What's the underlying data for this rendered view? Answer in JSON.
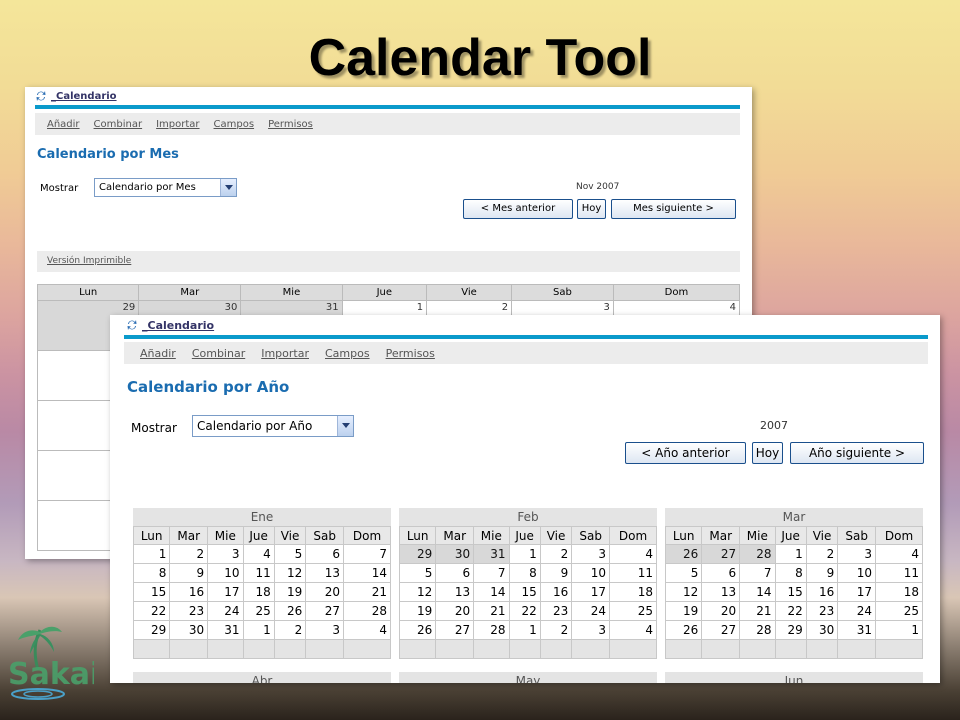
{
  "slide": {
    "title": "Calendar Tool",
    "logo_text": "Sakai"
  },
  "month_view": {
    "tool_name": "_Calendario",
    "menu": [
      "Añadir",
      "Combinar",
      "Importar",
      "Campos",
      "Permisos"
    ],
    "title": "Calendario por Mes",
    "show_label": "Mostrar",
    "view_select": "Calendario por Mes",
    "period": "Nov 2007",
    "btn_prev": "< Mes anterior",
    "btn_today": "Hoy",
    "btn_next": "Mes siguiente >",
    "printable": "Versión Imprimible",
    "weekdays": [
      "Lun",
      "Mar",
      "Mie",
      "Jue",
      "Vie",
      "Sab",
      "Dom"
    ],
    "first_week": [
      "29",
      "30",
      "31",
      "1",
      "2",
      "3",
      "4"
    ]
  },
  "year_view": {
    "tool_name": "_Calendario",
    "menu": [
      "Añadir",
      "Combinar",
      "Importar",
      "Campos",
      "Permisos"
    ],
    "title": "Calendario por Año",
    "show_label": "Mostrar",
    "view_select": "Calendario por Año",
    "period": "2007",
    "btn_prev": "< Año anterior",
    "btn_today": "Hoy",
    "btn_next": "Año siguiente >",
    "weekdays": [
      "Lun",
      "Mar",
      "Mie",
      "Jue",
      "Vie",
      "Sab",
      "Dom"
    ],
    "months": [
      {
        "name": "Ene",
        "weeks": [
          [
            {
              "d": "1"
            },
            {
              "d": "2"
            },
            {
              "d": "3"
            },
            {
              "d": "4"
            },
            {
              "d": "5"
            },
            {
              "d": "6"
            },
            {
              "d": "7"
            }
          ],
          [
            {
              "d": "8"
            },
            {
              "d": "9"
            },
            {
              "d": "10"
            },
            {
              "d": "11"
            },
            {
              "d": "12"
            },
            {
              "d": "13"
            },
            {
              "d": "14"
            }
          ],
          [
            {
              "d": "15"
            },
            {
              "d": "16"
            },
            {
              "d": "17"
            },
            {
              "d": "18"
            },
            {
              "d": "19"
            },
            {
              "d": "20"
            },
            {
              "d": "21"
            }
          ],
          [
            {
              "d": "22"
            },
            {
              "d": "23"
            },
            {
              "d": "24"
            },
            {
              "d": "25"
            },
            {
              "d": "26"
            },
            {
              "d": "27"
            },
            {
              "d": "28"
            }
          ],
          [
            {
              "d": "29"
            },
            {
              "d": "30"
            },
            {
              "d": "31"
            },
            {
              "d": "1"
            },
            {
              "d": "2"
            },
            {
              "d": "3"
            },
            {
              "d": "4"
            }
          ]
        ]
      },
      {
        "name": "Feb",
        "weeks": [
          [
            {
              "d": "29",
              "o": true
            },
            {
              "d": "30",
              "o": true
            },
            {
              "d": "31",
              "o": true
            },
            {
              "d": "1"
            },
            {
              "d": "2"
            },
            {
              "d": "3"
            },
            {
              "d": "4"
            }
          ],
          [
            {
              "d": "5"
            },
            {
              "d": "6"
            },
            {
              "d": "7"
            },
            {
              "d": "8"
            },
            {
              "d": "9"
            },
            {
              "d": "10"
            },
            {
              "d": "11"
            }
          ],
          [
            {
              "d": "12"
            },
            {
              "d": "13"
            },
            {
              "d": "14"
            },
            {
              "d": "15"
            },
            {
              "d": "16"
            },
            {
              "d": "17"
            },
            {
              "d": "18"
            }
          ],
          [
            {
              "d": "19"
            },
            {
              "d": "20"
            },
            {
              "d": "21"
            },
            {
              "d": "22"
            },
            {
              "d": "23"
            },
            {
              "d": "24"
            },
            {
              "d": "25"
            }
          ],
          [
            {
              "d": "26"
            },
            {
              "d": "27"
            },
            {
              "d": "28"
            },
            {
              "d": "1"
            },
            {
              "d": "2"
            },
            {
              "d": "3"
            },
            {
              "d": "4"
            }
          ]
        ]
      },
      {
        "name": "Mar",
        "weeks": [
          [
            {
              "d": "26",
              "o": true
            },
            {
              "d": "27",
              "o": true
            },
            {
              "d": "28",
              "o": true
            },
            {
              "d": "1"
            },
            {
              "d": "2"
            },
            {
              "d": "3"
            },
            {
              "d": "4"
            }
          ],
          [
            {
              "d": "5"
            },
            {
              "d": "6"
            },
            {
              "d": "7"
            },
            {
              "d": "8"
            },
            {
              "d": "9"
            },
            {
              "d": "10"
            },
            {
              "d": "11"
            }
          ],
          [
            {
              "d": "12"
            },
            {
              "d": "13"
            },
            {
              "d": "14"
            },
            {
              "d": "15"
            },
            {
              "d": "16"
            },
            {
              "d": "17"
            },
            {
              "d": "18"
            }
          ],
          [
            {
              "d": "19"
            },
            {
              "d": "20"
            },
            {
              "d": "21"
            },
            {
              "d": "22"
            },
            {
              "d": "23"
            },
            {
              "d": "24"
            },
            {
              "d": "25"
            }
          ],
          [
            {
              "d": "26"
            },
            {
              "d": "27"
            },
            {
              "d": "28"
            },
            {
              "d": "29"
            },
            {
              "d": "30"
            },
            {
              "d": "31"
            },
            {
              "d": "1"
            }
          ]
        ]
      }
    ],
    "next_row_months": [
      "Abr",
      "May",
      "Jun"
    ]
  }
}
